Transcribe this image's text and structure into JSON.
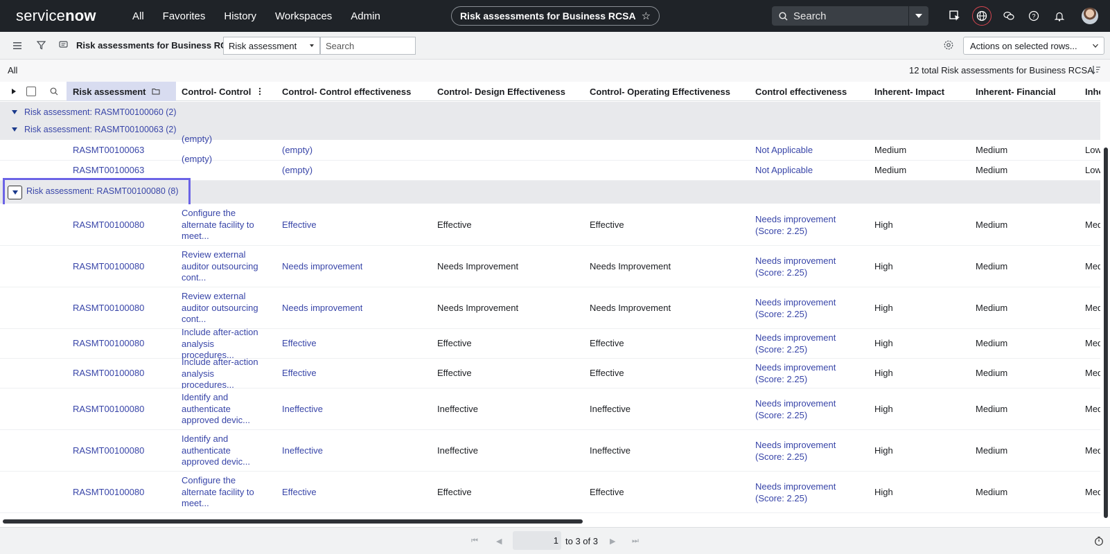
{
  "nav": {
    "logo": "servicenow",
    "links": [
      "All",
      "Favorites",
      "History",
      "Workspaces",
      "Admin"
    ],
    "title": "Risk assessments for Business RCSA",
    "search_placeholder": "Search",
    "icons": [
      "select-icon",
      "globe-icon",
      "chat-icon",
      "help-icon",
      "bell-icon",
      "avatar"
    ]
  },
  "toolbar": {
    "title": "Risk assessments for Business RCSA",
    "search_field": "Risk assessment",
    "search_placeholder": "Search",
    "actions": "Actions on selected rows..."
  },
  "breadcrumb": "All",
  "total": "12 total Risk assessments for Business RCSA",
  "columns": [
    "Risk assessment",
    "Control- Control",
    "Control- Control effectiveness",
    "Control- Design Effectiveness",
    "Control- Operating Effectiveness",
    "Control effectiveness",
    "Inherent- Impact",
    "Inherent- Financial",
    "Inhe"
  ],
  "groups": [
    {
      "label": "Risk assessment: RASMT00100060 (2)"
    },
    {
      "label": "Risk assessment: RASMT00100063 (2)"
    },
    {
      "label": "Risk assessment: RASMT00100080 (8)"
    }
  ],
  "rows_063": [
    {
      "ra": "RASMT00100063",
      "control": "(empty)",
      "ce": "(empty)",
      "de": "",
      "oe": "",
      "eff": "Not Applicable",
      "impact": "Medium",
      "fin": "Medium",
      "inh": "Low"
    },
    {
      "ra": "RASMT00100063",
      "control": "(empty)",
      "ce": "(empty)",
      "de": "",
      "oe": "",
      "eff": "Not Applicable",
      "impact": "Medium",
      "fin": "Medium",
      "inh": "Low"
    }
  ],
  "rows_080": [
    {
      "ra": "RASMT00100080",
      "control": "Configure the alternate facility to meet...",
      "ce": "Effective",
      "de": "Effective",
      "oe": "Effective",
      "eff": "Needs improvement (Score: 2.25)",
      "impact": "High",
      "fin": "Medium",
      "inh": "Med"
    },
    {
      "ra": "RASMT00100080",
      "control": "Review external auditor outsourcing cont...",
      "ce": "Needs improvement",
      "de": "Needs Improvement",
      "oe": "Needs Improvement",
      "eff": "Needs improvement (Score: 2.25)",
      "impact": "High",
      "fin": "Medium",
      "inh": "Med"
    },
    {
      "ra": "RASMT00100080",
      "control": "Review external auditor outsourcing cont...",
      "ce": "Needs improvement",
      "de": "Needs Improvement",
      "oe": "Needs Improvement",
      "eff": "Needs improvement (Score: 2.25)",
      "impact": "High",
      "fin": "Medium",
      "inh": "Med"
    },
    {
      "ra": "RASMT00100080",
      "control": "Include after-action analysis procedures...",
      "ce": "Effective",
      "de": "Effective",
      "oe": "Effective",
      "eff": "Needs improvement (Score: 2.25)",
      "impact": "High",
      "fin": "Medium",
      "inh": "Med"
    },
    {
      "ra": "RASMT00100080",
      "control": "Include after-action analysis procedures...",
      "ce": "Effective",
      "de": "Effective",
      "oe": "Effective",
      "eff": "Needs improvement (Score: 2.25)",
      "impact": "High",
      "fin": "Medium",
      "inh": "Med"
    },
    {
      "ra": "RASMT00100080",
      "control": "Identify and authenticate approved devic...",
      "ce": "Ineffective",
      "de": "Ineffective",
      "oe": "Ineffective",
      "eff": "Needs improvement (Score: 2.25)",
      "impact": "High",
      "fin": "Medium",
      "inh": "Med"
    },
    {
      "ra": "RASMT00100080",
      "control": "Identify and authenticate approved devic...",
      "ce": "Ineffective",
      "de": "Ineffective",
      "oe": "Ineffective",
      "eff": "Needs improvement (Score: 2.25)",
      "impact": "High",
      "fin": "Medium",
      "inh": "Med"
    },
    {
      "ra": "RASMT00100080",
      "control": "Configure the alternate facility to meet...",
      "ce": "Effective",
      "de": "Effective",
      "oe": "Effective",
      "eff": "Needs improvement (Score: 2.25)",
      "impact": "High",
      "fin": "Medium",
      "inh": "Med"
    }
  ],
  "pagination": {
    "page": "1",
    "text": "to 3 of 3"
  }
}
